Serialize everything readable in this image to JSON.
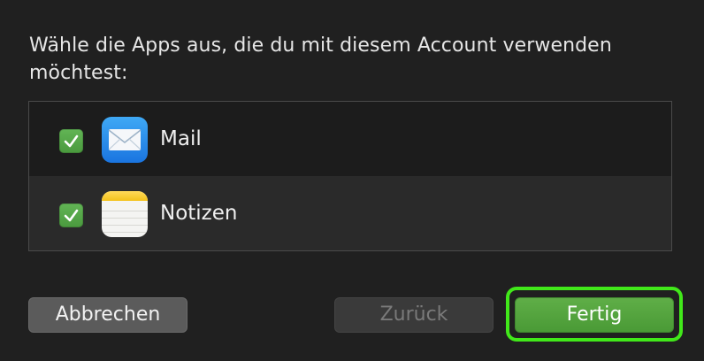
{
  "dialog": {
    "prompt": "Wähle die Apps aus, die du mit diesem Account verwenden möchtest:"
  },
  "apps": [
    {
      "name": "Mail",
      "checked": true,
      "icon": "mail-icon"
    },
    {
      "name": "Notizen",
      "checked": true,
      "icon": "notes-icon"
    }
  ],
  "buttons": {
    "cancel_label": "Abbrechen",
    "back_label": "Zurück",
    "done_label": "Fertig"
  },
  "colors": {
    "accent": "#4fa33c",
    "highlight_outline": "#41e81a",
    "background": "#202020"
  }
}
